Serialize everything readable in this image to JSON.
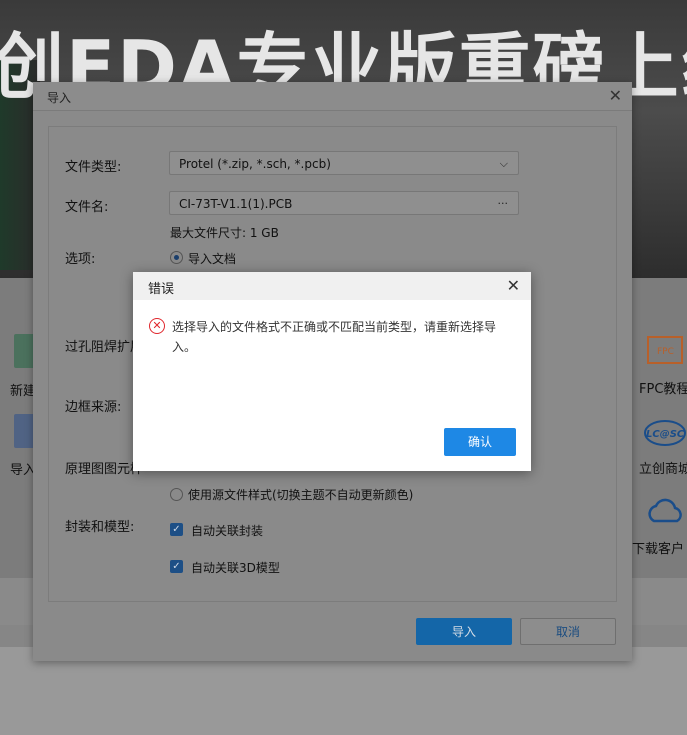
{
  "banner": {
    "title": "创EDA专业版重磅上线"
  },
  "background_items": {
    "left_1": "新建",
    "left_2": "导入",
    "right_1": "FPC教程",
    "right_2": "立创商城",
    "right_3": "下载客户",
    "lcsc_logo_text": "LC@SC"
  },
  "import_dialog": {
    "title": "导入",
    "file_type_label": "文件类型:",
    "file_type_value": "Protel (*.zip, *.sch, *.pcb)",
    "file_name_label": "文件名:",
    "file_name_value": "CI-73T-V1.1(1).PCB",
    "file_name_more": "···",
    "max_size_text": "最大文件尺寸: 1 GB",
    "options_label": "选项:",
    "option_import_doc": "导入文档",
    "via_label": "过孔阻焊扩展",
    "border_label": "边框来源:",
    "schematic_label": "原理图图元样",
    "use_source_style": "使用源文件样式(切换主题不自动更新颜色)",
    "footprint_label": "封装和模型:",
    "auto_footprint": "自动关联封装",
    "auto_3d": "自动关联3D模型",
    "import_button": "导入",
    "cancel_button": "取消"
  },
  "error_dialog": {
    "title": "错误",
    "message": "选择导入的文件格式不正确或不匹配当前类型，请重新选择导入。",
    "ok_button": "确认"
  },
  "colors": {
    "primary": "#1e88e5",
    "error": "#e0282e"
  }
}
